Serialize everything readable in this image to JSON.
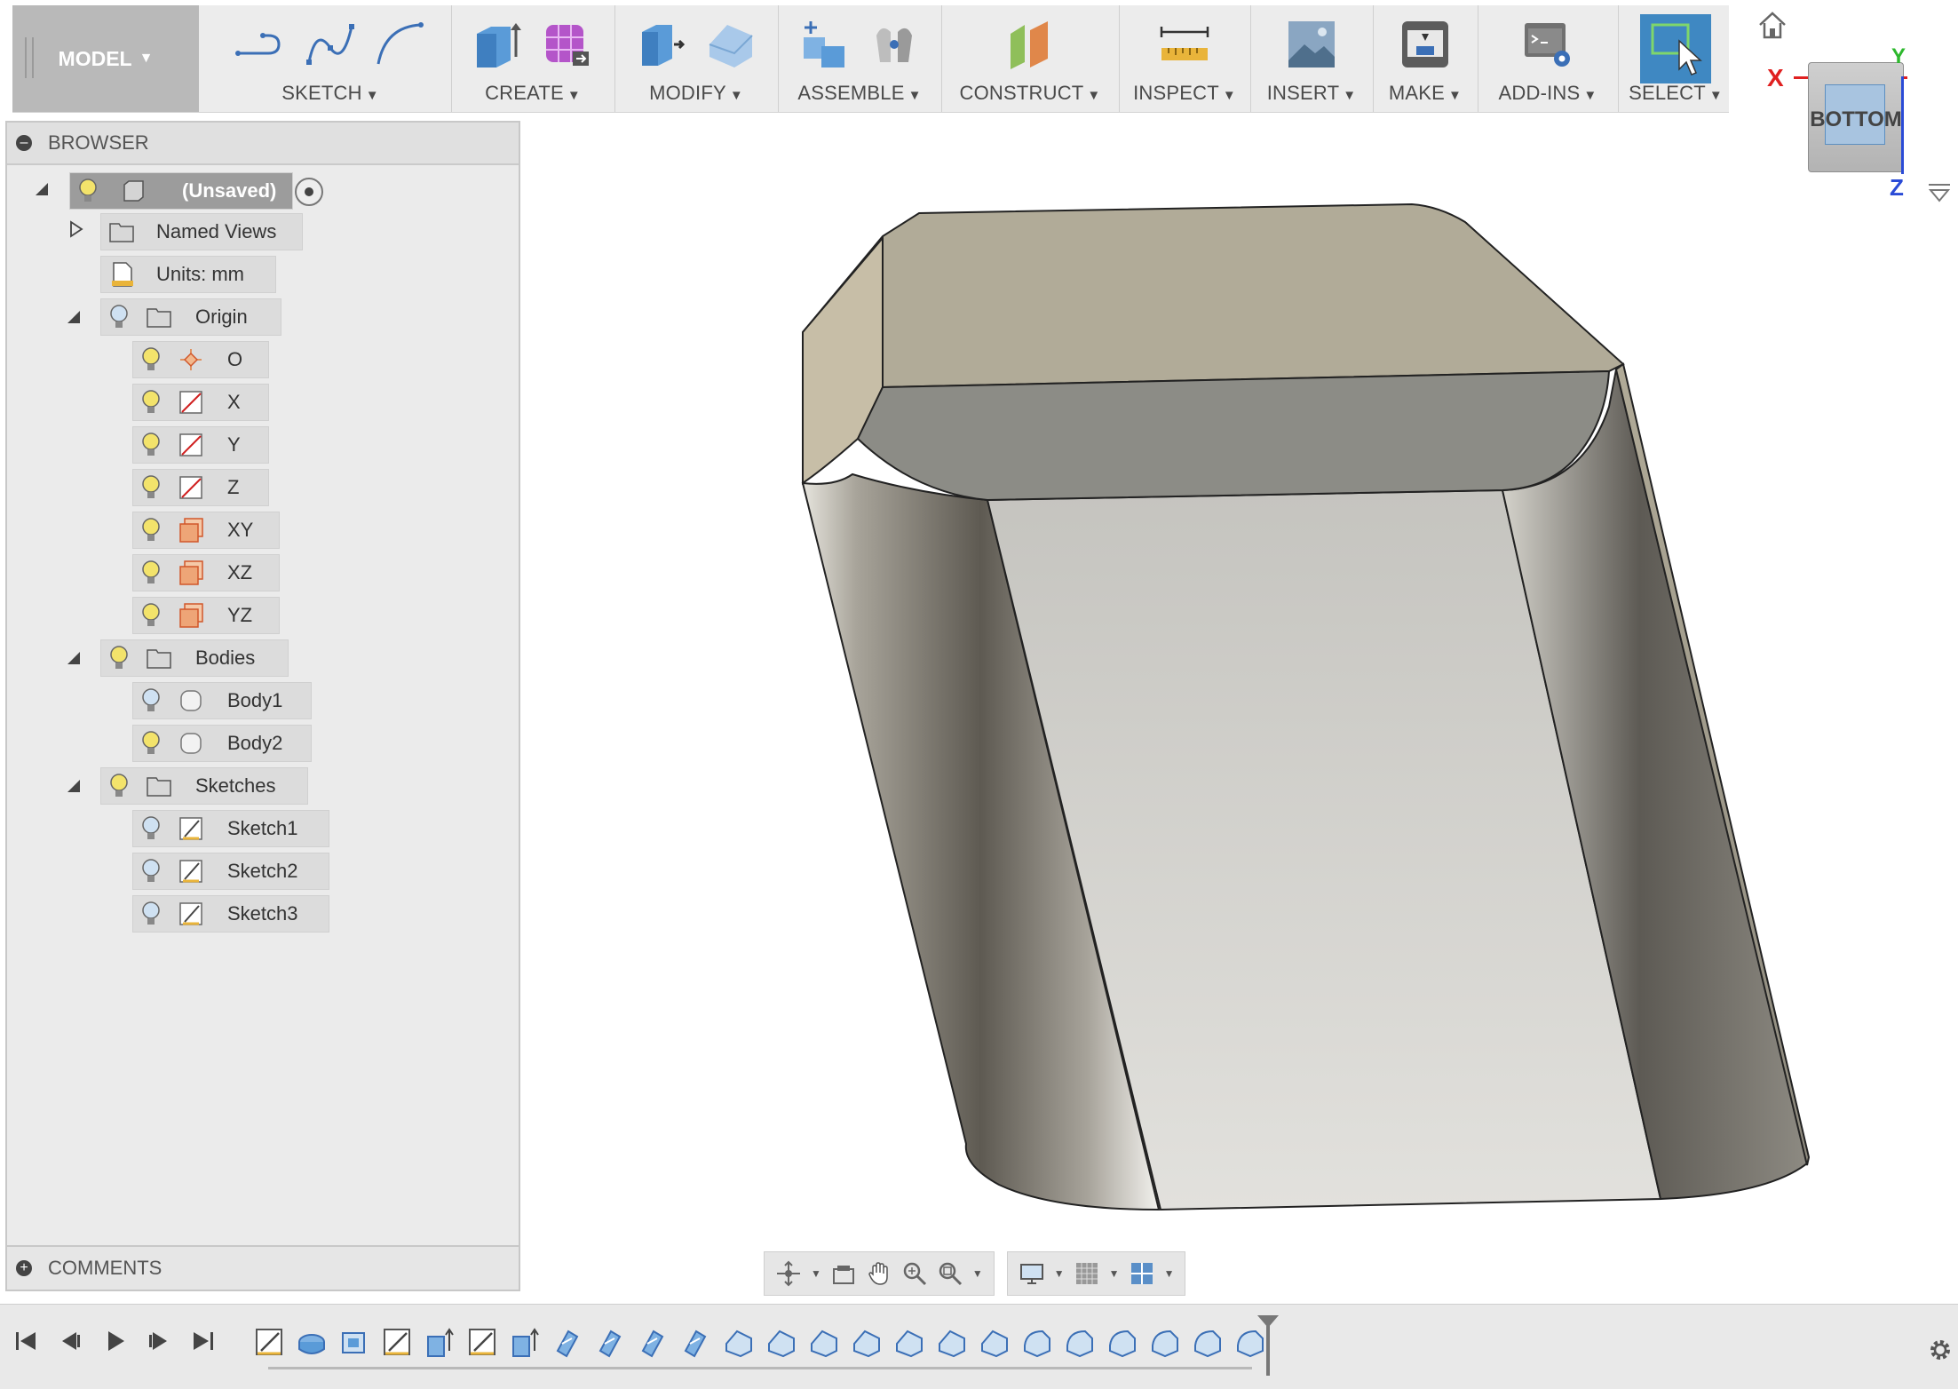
{
  "toolbar": {
    "workspace": "MODEL",
    "groups": [
      {
        "label": "SKETCH"
      },
      {
        "label": "CREATE"
      },
      {
        "label": "MODIFY"
      },
      {
        "label": "ASSEMBLE"
      },
      {
        "label": "CONSTRUCT"
      },
      {
        "label": "INSPECT"
      },
      {
        "label": "INSERT"
      },
      {
        "label": "MAKE"
      },
      {
        "label": "ADD-INS"
      },
      {
        "label": "SELECT"
      }
    ]
  },
  "viewcube": {
    "face": "BOTTOM",
    "axis_x": "X",
    "axis_y": "Y",
    "axis_z": "Z"
  },
  "browser": {
    "title": "BROWSER",
    "document": "(Unsaved)",
    "named_views": "Named Views",
    "units": "Units: mm",
    "origin": {
      "label": "Origin",
      "items": [
        "O",
        "X",
        "Y",
        "Z",
        "XY",
        "XZ",
        "YZ"
      ]
    },
    "bodies": {
      "label": "Bodies",
      "items": [
        "Body1",
        "Body2"
      ]
    },
    "sketches": {
      "label": "Sketches",
      "items": [
        "Sketch1",
        "Sketch2",
        "Sketch3"
      ]
    }
  },
  "comments": {
    "title": "COMMENTS"
  },
  "colors": {
    "accent_select": "#3f88c2",
    "axis_x": "#e02020",
    "axis_y": "#2db82d",
    "axis_z": "#2a4bd6"
  }
}
